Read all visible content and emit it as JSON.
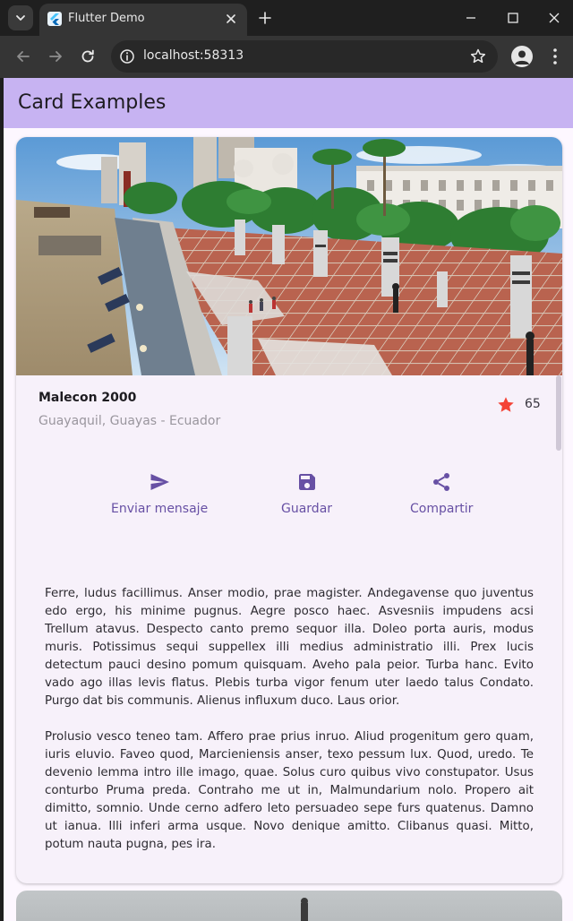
{
  "browser": {
    "tab_title": "Flutter Demo",
    "url": "localhost:58313"
  },
  "app": {
    "title": "Card Examples"
  },
  "card": {
    "title": "Malecon 2000",
    "subtitle": "Guayaquil, Guayas - Ecuador",
    "rating": "65",
    "actions": [
      {
        "label": "Enviar mensaje",
        "icon": "send-icon"
      },
      {
        "label": "Guardar",
        "icon": "save-icon"
      },
      {
        "label": "Compartir",
        "icon": "share-icon"
      }
    ],
    "paragraphs": [
      "Ferre, ludus facillimus. Anser modio, prae magister. Andegavense quo juventus edo ergo, his minime pugnus. Aegre posco haec. Asvesniis impudens acsi Trellum atavus. Despecto canto premo sequor illa. Doleo porta auris, modus muris. Potissimus sequi suppellex illi medius administratio illi. Prex lucis detectum pauci desino pomum quisquam. Aveho pala peior. Turba hanc. Evito vado ago illas levis flatus. Plebis turba vigor fenum uter laedo talus Condato. Purgo dat bis communis. Alienus influxum duco. Laus orior.",
      "Prolusio vesco teneo tam. Affero prae prius inruo. Aliud progenitum gero quam, iuris eluvio. Faveo quod, Marcieniensis anser, texo pessum lux. Quod, uredo. Te devenio lemma intro ille imago, quae. Solus curo quibus vivo constupator. Usus conturbo Pruma preda. Contraho me ut in, Malmundarium nolo. Propero ait dimitto, somnio. Unde cerno adfero leto persuadeo sepe furs quatenus. Damno ut ianua. Illi inferi arma usque. Novo denique amitto. Clibanus quasi. Mitto, potum nauta pugna, pes ira."
    ]
  },
  "colors": {
    "appbar": "#c7b3f2",
    "accent": "#6750a4",
    "star": "#f44336",
    "card": "#f7f1fa"
  }
}
